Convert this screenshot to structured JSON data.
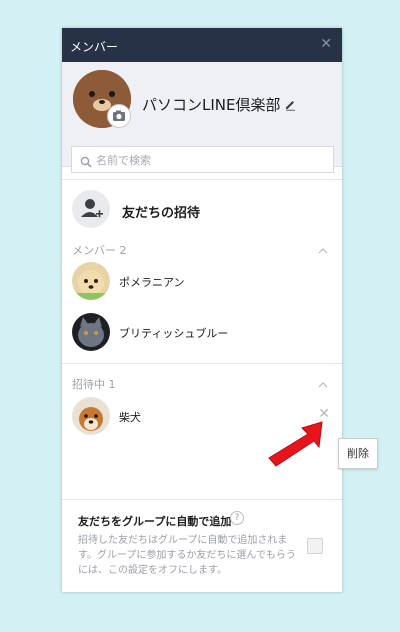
{
  "window": {
    "title": "メンバー",
    "close_icon": "close-icon"
  },
  "group": {
    "name": "パソコンLINE倶楽部"
  },
  "search": {
    "placeholder": "名前で検索"
  },
  "invite": {
    "label": "友だちの招待"
  },
  "members_section": {
    "header": "メンバー 2",
    "items": [
      {
        "name": "ポメラニアン"
      },
      {
        "name": "ブリティッシュブルー"
      }
    ]
  },
  "invited_section": {
    "header": "招待中 1",
    "items": [
      {
        "name": "柴犬"
      }
    ]
  },
  "auto_add": {
    "title": "友だちをグループに自動で追加",
    "description": "招待した友だちはグループに自動で追加されます。グループに参加するか友だちに選んでもらうには、この設定をオフにします。"
  },
  "tooltip": {
    "label": "削除"
  },
  "colors": {
    "titlebar": "#283246",
    "background": "#d3f1f5",
    "arrow": "#e8141b"
  }
}
